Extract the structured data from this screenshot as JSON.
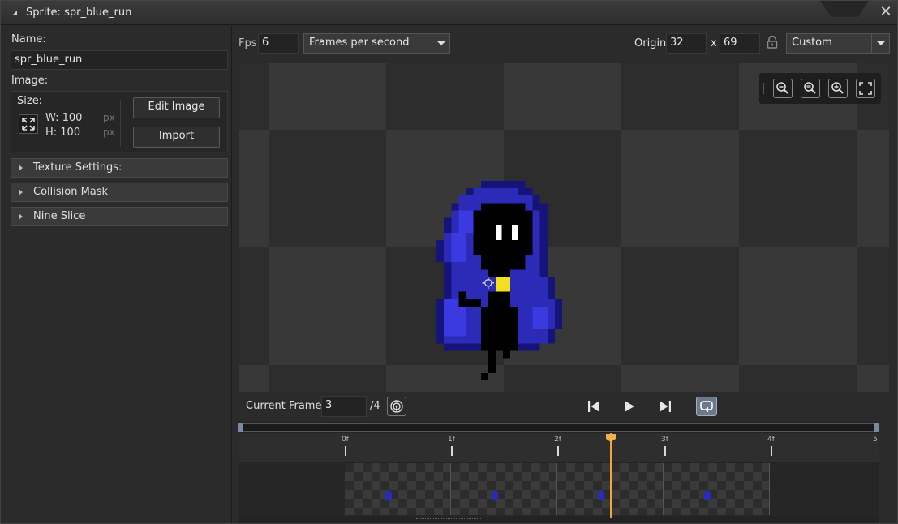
{
  "window": {
    "title": "Sprite: spr_blue_run",
    "close_symbol": "✕"
  },
  "left_panel": {
    "name_label": "Name:",
    "name_value": "spr_blue_run",
    "image_label": "Image:",
    "size_label": "Size:",
    "width_text": "W: 100",
    "height_text": "H: 100",
    "unit_w": "px",
    "unit_h": "px",
    "edit_image_label": "Edit Image",
    "import_label": "Import",
    "sections": [
      "Texture Settings:",
      "Collision Mask",
      "Nine Slice"
    ]
  },
  "toolbar": {
    "fps_label": "Fps",
    "fps_value": "6",
    "speed_mode": "Frames per second",
    "origin_label": "Origin",
    "origin_x": "32",
    "origin_sep": "x",
    "origin_y": "69",
    "origin_mode": "Custom"
  },
  "playback": {
    "current_frame_label": "Current Frame:",
    "current_frame_value": "3",
    "total_frames": "/4"
  },
  "timeline": {
    "ticks": [
      "0f",
      "1f",
      "2f",
      "3f",
      "4f",
      "5"
    ],
    "playhead_frame": 2.5
  },
  "colors": {
    "accent_playhead": "#f0a830",
    "sprite_blue": "#2b2bb8",
    "sprite_dark_blue": "#14147a",
    "sprite_highlight": "#3a3ae0",
    "sprite_yellow": "#f0e020"
  },
  "icons": {
    "zoom_out": "zoom-out-icon",
    "zoom_out_alt": "zoom-out-icon",
    "zoom_in": "zoom-in-icon",
    "fit": "fullscreen-icon",
    "lock": "lock-icon",
    "onion": "onion-skin-icon",
    "first": "skip-back-icon",
    "play": "play-icon",
    "last": "skip-forward-icon",
    "loop": "loop-icon"
  }
}
